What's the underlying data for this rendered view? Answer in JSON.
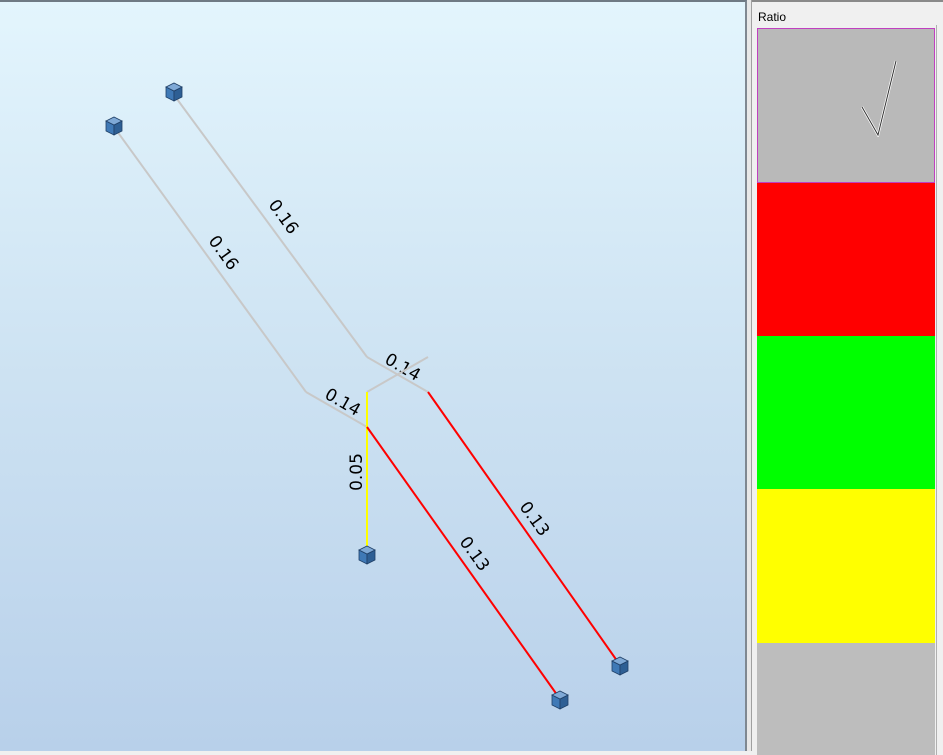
{
  "legend": {
    "title": "Ratio",
    "swatches": [
      {
        "color": "#b9b9b9",
        "selected": true,
        "icon": "check-icon"
      },
      {
        "color": "#ff0000",
        "selected": false
      },
      {
        "color": "#00ff00",
        "selected": false
      },
      {
        "color": "#ffff00",
        "selected": false
      },
      {
        "color": "#bdbdbd",
        "selected": false
      }
    ]
  },
  "members": [
    {
      "id": "m1",
      "label": "0.16",
      "color": "#c8c8c8"
    },
    {
      "id": "m2",
      "label": "0.16",
      "color": "#c8c8c8"
    },
    {
      "id": "m3",
      "label": "0.14",
      "color": "#c8c8c8"
    },
    {
      "id": "m4",
      "label": "0.14",
      "color": "#c8c8c8"
    },
    {
      "id": "m5",
      "label": "0.05",
      "color": "#ffff00"
    },
    {
      "id": "m6",
      "label": "0.13",
      "color": "#ff0000"
    },
    {
      "id": "m7",
      "label": "0.13",
      "color": "#ff0000"
    }
  ],
  "supports": {
    "color": "#3f79b6",
    "icon": "support-node-icon"
  }
}
